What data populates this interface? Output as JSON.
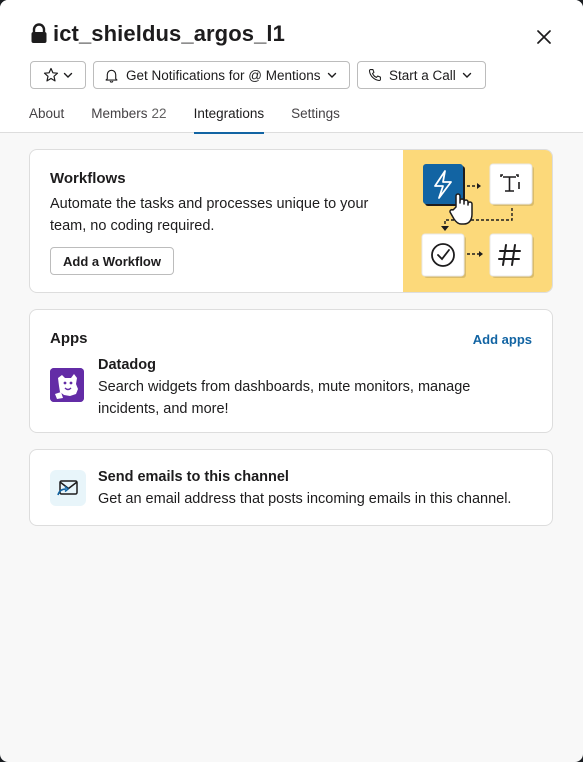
{
  "channel": {
    "name": "ict_shieldus_argos_l1"
  },
  "actions": {
    "notifications_label": "Get Notifications for @ Mentions",
    "call_label": "Start a Call"
  },
  "tabs": [
    {
      "label": "About"
    },
    {
      "label": "Members",
      "count": "22"
    },
    {
      "label": "Integrations",
      "active": true
    },
    {
      "label": "Settings"
    }
  ],
  "workflows": {
    "title": "Workflows",
    "description": "Automate the tasks and processes unique to your team, no coding required.",
    "button_label": "Add a Workflow"
  },
  "apps": {
    "title": "Apps",
    "add_label": "Add apps",
    "items": [
      {
        "name": "Datadog",
        "description": "Search widgets from dashboards, mute monitors, manage incidents, and more!"
      }
    ]
  },
  "email": {
    "title": "Send emails to this channel",
    "description": "Get an email address that posts incoming emails in this channel."
  },
  "colors": {
    "accent": "#1264a3",
    "tab_underline": "#1264a3",
    "workflow_bg": "#fcd97a",
    "datadog": "#632ca6"
  }
}
